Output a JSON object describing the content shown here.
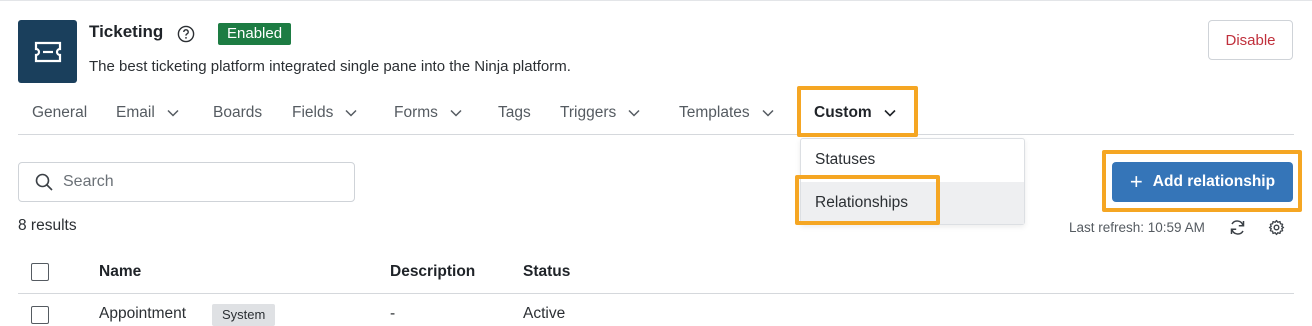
{
  "app": {
    "title": "Ticketing",
    "status_badge": "Enabled",
    "description": "The best ticketing platform integrated single pane into the Ninja platform.",
    "disable_label": "Disable"
  },
  "tabs": [
    {
      "label": "General",
      "has_menu": false
    },
    {
      "label": "Email",
      "has_menu": true
    },
    {
      "label": "Boards",
      "has_menu": false
    },
    {
      "label": "Fields",
      "has_menu": true
    },
    {
      "label": "Forms",
      "has_menu": true
    },
    {
      "label": "Tags",
      "has_menu": false
    },
    {
      "label": "Triggers",
      "has_menu": true
    },
    {
      "label": "Templates",
      "has_menu": true
    },
    {
      "label": "Custom",
      "has_menu": true,
      "active": true
    }
  ],
  "custom_menu": {
    "items": [
      "Statuses",
      "Relationships"
    ],
    "hovered": "Relationships"
  },
  "search": {
    "placeholder": "Search",
    "value": ""
  },
  "add_button": {
    "label": "Add relationship"
  },
  "results_text": "8 results",
  "last_refresh": "Last refresh: 10:59 AM",
  "table": {
    "columns": [
      "Name",
      "Description",
      "Status"
    ],
    "rows": [
      {
        "name": "Appointment",
        "tag": "System",
        "description": "-",
        "status": "Active"
      }
    ]
  },
  "colors": {
    "highlight": "#f5a623",
    "primary": "#3575b8",
    "enabled_badge": "#1d7c43",
    "danger": "#c0303c",
    "logo_bg": "#1a3f5c"
  }
}
